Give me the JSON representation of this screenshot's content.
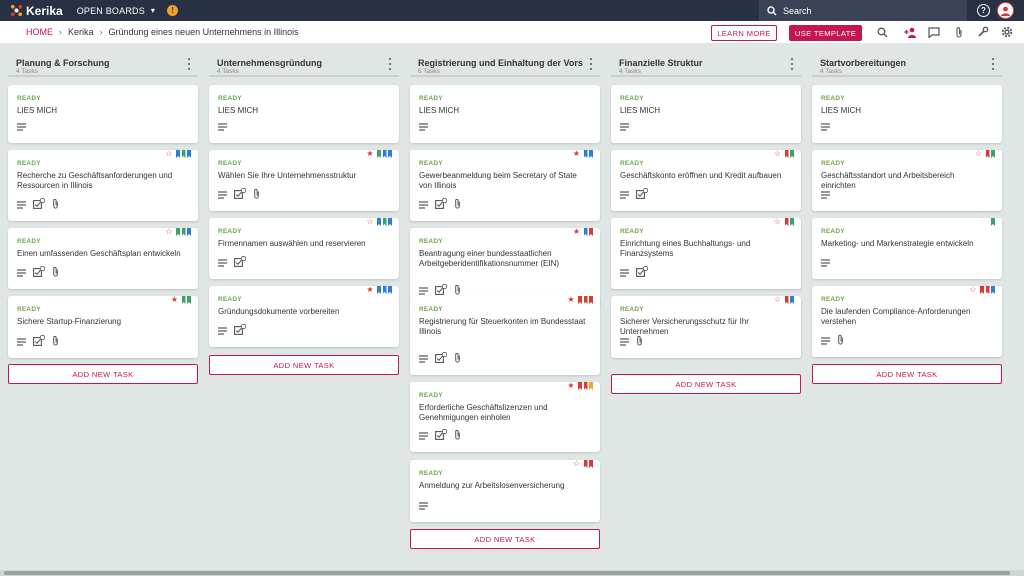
{
  "topbar": {
    "logo_text": "Kerika",
    "open_boards_label": "OPEN BOARDS",
    "search_placeholder": "Search",
    "help_symbol": "?"
  },
  "breadcrumb": {
    "home": "HOME",
    "account": "Kerika",
    "board": "Gründung eines neuen Unternehmens in Illinois"
  },
  "toolbar": {
    "learn_more": "LEARN MORE",
    "use_template": "USE TEMPLATE"
  },
  "colors": {
    "accent": "#c4174f",
    "topbar": "#283143",
    "ready": "#6aa84f",
    "flag_blue": "#2d7fd3",
    "flag_green": "#3aa36b",
    "flag_red": "#d93a34",
    "flag_orange": "#f2a21b"
  },
  "columns": [
    {
      "title": "Planung & Forschung",
      "count": "4 Tasks",
      "add_label": "ADD NEW TASK",
      "cards": [
        {
          "status": "READY",
          "title": "LIES MICH",
          "star": "",
          "flags": [],
          "icons": [
            "description-icon"
          ]
        },
        {
          "status": "READY",
          "title": "Recherche zu Geschäftsanforderungen und Ressourcen in Illinois",
          "star": "☆",
          "flags": [
            "blue",
            "green",
            "blue"
          ],
          "icons": [
            "description-icon",
            "checklist-icon",
            "attachment-icon"
          ]
        },
        {
          "status": "READY",
          "title": "Einen umfassenden Geschäftsplan entwickeln",
          "star": "☆",
          "flags": [
            "green",
            "green",
            "blue"
          ],
          "icons": [
            "description-icon",
            "checklist-icon",
            "attachment-icon"
          ]
        },
        {
          "status": "READY",
          "title": "Sichere Startup-Finanzierung",
          "star": "★",
          "flags": [
            "green",
            "green"
          ],
          "icons": [
            "description-icon",
            "checklist-icon",
            "attachment-icon"
          ]
        }
      ]
    },
    {
      "title": "Unternehmensgründung",
      "count": "4 Tasks",
      "add_label": "ADD NEW TASK",
      "cards": [
        {
          "status": "READY",
          "title": "LIES MICH",
          "star": "",
          "flags": [],
          "icons": [
            "description-icon"
          ]
        },
        {
          "status": "READY",
          "title": "Wählen Sie Ihre Unternehmensstruktur",
          "star": "★",
          "flags": [
            "green",
            "blue",
            "blue"
          ],
          "icons": [
            "description-icon",
            "checklist-icon",
            "attachment-icon"
          ]
        },
        {
          "status": "READY",
          "title": "Firmennamen auswählen und reservieren",
          "star": "☆",
          "flags": [
            "blue",
            "green",
            "blue"
          ],
          "icons": [
            "description-icon",
            "checklist-icon"
          ]
        },
        {
          "status": "READY",
          "title": "Gründungsdokumente vorbereiten",
          "star": "★",
          "flags": [
            "blue",
            "blue",
            "blue"
          ],
          "icons": [
            "description-icon",
            "checklist-icon"
          ]
        }
      ]
    },
    {
      "title": "Registrierung und Einhaltung der Vorschr...",
      "count": "6 Tasks",
      "add_label": "ADD NEW TASK",
      "cards": [
        {
          "status": "READY",
          "title": "LIES MICH",
          "star": "",
          "flags": [],
          "icons": [
            "description-icon"
          ]
        },
        {
          "status": "READY",
          "title": "Gewerbeanmeldung beim Secretary of State von Illinois",
          "star": "★",
          "flags": [
            "blue",
            "blue"
          ],
          "icons": [
            "description-icon",
            "checklist-icon",
            "attachment-icon"
          ]
        },
        {
          "status": "READY",
          "title": "Beantragung einer bundesstaatlichen Arbeitgeberidentifikationsnummer (EIN)",
          "star": "★",
          "flags": [
            "blue",
            "red"
          ],
          "icons": [
            "description-icon",
            "checklist-icon",
            "attachment-icon"
          ]
        },
        {
          "status": "READY",
          "title": "Registrierung für Steuerkonten im Bundesstaat Illinois",
          "star": "★",
          "flags": [
            "red",
            "red",
            "red"
          ],
          "icons": [
            "description-icon",
            "checklist-icon",
            "attachment-icon"
          ]
        },
        {
          "status": "READY",
          "title": "Erforderliche Geschäftslizenzen und Genehmigungen einholen",
          "star": "★",
          "flags": [
            "red",
            "red",
            "orange"
          ],
          "icons": [
            "description-icon",
            "checklist-icon",
            "attachment-icon"
          ]
        },
        {
          "status": "READY",
          "title": "Anmeldung zur Arbeitslosenversicherung",
          "star": "☆",
          "flags": [
            "red",
            "red"
          ],
          "icons": [
            "description-icon"
          ]
        }
      ]
    },
    {
      "title": "Finanzielle Struktur",
      "count": "4 Tasks",
      "add_label": "ADD NEW TASK",
      "cards": [
        {
          "status": "READY",
          "title": "LIES MICH",
          "star": "",
          "flags": [],
          "icons": [
            "description-icon"
          ]
        },
        {
          "status": "READY",
          "title": "Geschäftskonto eröffnen und Kredit aufbauen",
          "star": "☆",
          "flags": [
            "red",
            "green"
          ],
          "icons": [
            "description-icon",
            "checklist-icon"
          ]
        },
        {
          "status": "READY",
          "title": "Einrichtung eines Buchhaltungs- und Finanzsystems",
          "star": "☆",
          "flags": [
            "red",
            "green"
          ],
          "icons": [
            "description-icon",
            "checklist-icon"
          ]
        },
        {
          "status": "READY",
          "title": "Sicherer Versicherungsschutz für Ihr Unternehmen",
          "star": "☆",
          "flags": [
            "red",
            "blue"
          ],
          "icons": [
            "description-icon",
            "attachment-icon"
          ]
        }
      ]
    },
    {
      "title": "Startvorbereitungen",
      "count": "4 Tasks",
      "add_label": "ADD NEW TASK",
      "cards": [
        {
          "status": "READY",
          "title": "LIES MICH",
          "star": "",
          "flags": [],
          "icons": [
            "description-icon"
          ]
        },
        {
          "status": "READY",
          "title": "Geschäftsstandort und Arbeitsbereich einrichten",
          "star": "☆",
          "flags": [
            "red",
            "green"
          ],
          "icons": [
            "description-icon"
          ]
        },
        {
          "status": "READY",
          "title": "Marketing- und Markenstrategie entwickeln",
          "star": "",
          "flags": [
            "green"
          ],
          "icons": [
            "description-icon"
          ]
        },
        {
          "status": "READY",
          "title": "Die laufenden Compliance-Anforderungen verstehen",
          "star": "☆",
          "flags": [
            "red",
            "red",
            "blue"
          ],
          "icons": [
            "description-icon",
            "attachment-icon"
          ]
        }
      ]
    }
  ]
}
